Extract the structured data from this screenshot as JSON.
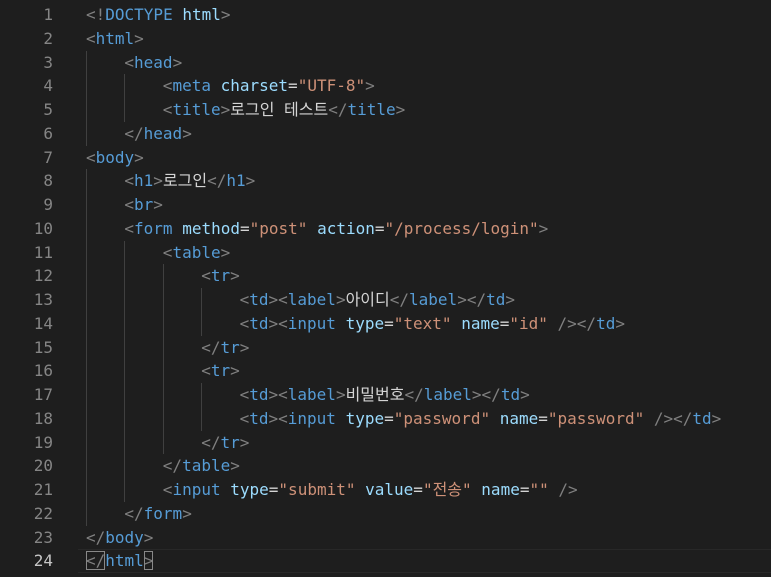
{
  "editor": {
    "current_line": 24,
    "colors": {
      "background": "#1e1e1e",
      "line_number": "#858585",
      "line_number_active": "#c6c6c6",
      "punctuation": "#808080",
      "tag": "#569cd6",
      "attribute": "#9cdcfe",
      "string": "#ce9178",
      "text": "#d4d4d4"
    },
    "lines": [
      {
        "n": "1",
        "indent": 0,
        "tokens": [
          [
            "punct",
            "<!"
          ],
          [
            "tag",
            "DOCTYPE"
          ],
          [
            "text",
            " "
          ],
          [
            "attr",
            "html"
          ],
          [
            "punct",
            ">"
          ]
        ]
      },
      {
        "n": "2",
        "indent": 0,
        "tokens": [
          [
            "punct",
            "<"
          ],
          [
            "tag",
            "html"
          ],
          [
            "punct",
            ">"
          ]
        ]
      },
      {
        "n": "3",
        "indent": 1,
        "tokens": [
          [
            "punct",
            "<"
          ],
          [
            "tag",
            "head"
          ],
          [
            "punct",
            ">"
          ]
        ]
      },
      {
        "n": "4",
        "indent": 2,
        "tokens": [
          [
            "punct",
            "<"
          ],
          [
            "tag",
            "meta"
          ],
          [
            "text",
            " "
          ],
          [
            "attr",
            "charset"
          ],
          [
            "eq",
            "="
          ],
          [
            "str",
            "\"UTF-8\""
          ],
          [
            "punct",
            ">"
          ]
        ]
      },
      {
        "n": "5",
        "indent": 2,
        "tokens": [
          [
            "punct",
            "<"
          ],
          [
            "tag",
            "title"
          ],
          [
            "punct",
            ">"
          ],
          [
            "text",
            "로그인 테스트"
          ],
          [
            "punct",
            "</"
          ],
          [
            "tag",
            "title"
          ],
          [
            "punct",
            ">"
          ]
        ]
      },
      {
        "n": "6",
        "indent": 1,
        "tokens": [
          [
            "punct",
            "</"
          ],
          [
            "tag",
            "head"
          ],
          [
            "punct",
            ">"
          ]
        ]
      },
      {
        "n": "7",
        "indent": 0,
        "tokens": [
          [
            "punct",
            "<"
          ],
          [
            "tag",
            "body"
          ],
          [
            "punct",
            ">"
          ]
        ]
      },
      {
        "n": "8",
        "indent": 1,
        "tokens": [
          [
            "punct",
            "<"
          ],
          [
            "tag",
            "h1"
          ],
          [
            "punct",
            ">"
          ],
          [
            "text",
            "로그인"
          ],
          [
            "punct",
            "</"
          ],
          [
            "tag",
            "h1"
          ],
          [
            "punct",
            ">"
          ]
        ]
      },
      {
        "n": "9",
        "indent": 1,
        "tokens": [
          [
            "punct",
            "<"
          ],
          [
            "tag",
            "br"
          ],
          [
            "punct",
            ">"
          ]
        ]
      },
      {
        "n": "10",
        "indent": 1,
        "tokens": [
          [
            "punct",
            "<"
          ],
          [
            "tag",
            "form"
          ],
          [
            "text",
            " "
          ],
          [
            "attr",
            "method"
          ],
          [
            "eq",
            "="
          ],
          [
            "str",
            "\"post\""
          ],
          [
            "text",
            " "
          ],
          [
            "attr",
            "action"
          ],
          [
            "eq",
            "="
          ],
          [
            "str",
            "\"/process/login\""
          ],
          [
            "punct",
            ">"
          ]
        ]
      },
      {
        "n": "11",
        "indent": 2,
        "tokens": [
          [
            "punct",
            "<"
          ],
          [
            "tag",
            "table"
          ],
          [
            "punct",
            ">"
          ]
        ]
      },
      {
        "n": "12",
        "indent": 3,
        "tokens": [
          [
            "punct",
            "<"
          ],
          [
            "tag",
            "tr"
          ],
          [
            "punct",
            ">"
          ]
        ]
      },
      {
        "n": "13",
        "indent": 4,
        "tokens": [
          [
            "punct",
            "<"
          ],
          [
            "tag",
            "td"
          ],
          [
            "punct",
            "><"
          ],
          [
            "tag",
            "label"
          ],
          [
            "punct",
            ">"
          ],
          [
            "text",
            "아이디"
          ],
          [
            "punct",
            "</"
          ],
          [
            "tag",
            "label"
          ],
          [
            "punct",
            "></"
          ],
          [
            "tag",
            "td"
          ],
          [
            "punct",
            ">"
          ]
        ]
      },
      {
        "n": "14",
        "indent": 4,
        "tokens": [
          [
            "punct",
            "<"
          ],
          [
            "tag",
            "td"
          ],
          [
            "punct",
            "><"
          ],
          [
            "tag",
            "input"
          ],
          [
            "text",
            " "
          ],
          [
            "attr",
            "type"
          ],
          [
            "eq",
            "="
          ],
          [
            "str",
            "\"text\""
          ],
          [
            "text",
            " "
          ],
          [
            "attr",
            "name"
          ],
          [
            "eq",
            "="
          ],
          [
            "str",
            "\"id\""
          ],
          [
            "text",
            " "
          ],
          [
            "punct",
            "/></"
          ],
          [
            "tag",
            "td"
          ],
          [
            "punct",
            ">"
          ]
        ]
      },
      {
        "n": "15",
        "indent": 3,
        "tokens": [
          [
            "punct",
            "</"
          ],
          [
            "tag",
            "tr"
          ],
          [
            "punct",
            ">"
          ]
        ]
      },
      {
        "n": "16",
        "indent": 3,
        "tokens": [
          [
            "punct",
            "<"
          ],
          [
            "tag",
            "tr"
          ],
          [
            "punct",
            ">"
          ]
        ]
      },
      {
        "n": "17",
        "indent": 4,
        "tokens": [
          [
            "punct",
            "<"
          ],
          [
            "tag",
            "td"
          ],
          [
            "punct",
            "><"
          ],
          [
            "tag",
            "label"
          ],
          [
            "punct",
            ">"
          ],
          [
            "text",
            "비밀번호"
          ],
          [
            "punct",
            "</"
          ],
          [
            "tag",
            "label"
          ],
          [
            "punct",
            "></"
          ],
          [
            "tag",
            "td"
          ],
          [
            "punct",
            ">"
          ]
        ]
      },
      {
        "n": "18",
        "indent": 4,
        "tokens": [
          [
            "punct",
            "<"
          ],
          [
            "tag",
            "td"
          ],
          [
            "punct",
            "><"
          ],
          [
            "tag",
            "input"
          ],
          [
            "text",
            " "
          ],
          [
            "attr",
            "type"
          ],
          [
            "eq",
            "="
          ],
          [
            "str",
            "\"password\""
          ],
          [
            "text",
            " "
          ],
          [
            "attr",
            "name"
          ],
          [
            "eq",
            "="
          ],
          [
            "str",
            "\"password\""
          ],
          [
            "text",
            " "
          ],
          [
            "punct",
            "/></"
          ],
          [
            "tag",
            "td"
          ],
          [
            "punct",
            ">"
          ]
        ]
      },
      {
        "n": "19",
        "indent": 3,
        "tokens": [
          [
            "punct",
            "</"
          ],
          [
            "tag",
            "tr"
          ],
          [
            "punct",
            ">"
          ]
        ]
      },
      {
        "n": "20",
        "indent": 2,
        "tokens": [
          [
            "punct",
            "</"
          ],
          [
            "tag",
            "table"
          ],
          [
            "punct",
            ">"
          ]
        ]
      },
      {
        "n": "21",
        "indent": 2,
        "tokens": [
          [
            "punct",
            "<"
          ],
          [
            "tag",
            "input"
          ],
          [
            "text",
            " "
          ],
          [
            "attr",
            "type"
          ],
          [
            "eq",
            "="
          ],
          [
            "str",
            "\"submit\""
          ],
          [
            "text",
            " "
          ],
          [
            "attr",
            "value"
          ],
          [
            "eq",
            "="
          ],
          [
            "str",
            "\"전송\""
          ],
          [
            "text",
            " "
          ],
          [
            "attr",
            "name"
          ],
          [
            "eq",
            "="
          ],
          [
            "str",
            "\"\""
          ],
          [
            "text",
            " "
          ],
          [
            "punct",
            "/>"
          ]
        ]
      },
      {
        "n": "22",
        "indent": 1,
        "tokens": [
          [
            "punct",
            "</"
          ],
          [
            "tag",
            "form"
          ],
          [
            "punct",
            ">"
          ]
        ]
      },
      {
        "n": "23",
        "indent": 0,
        "tokens": [
          [
            "punct",
            "</"
          ],
          [
            "tag",
            "body"
          ],
          [
            "punct",
            ">"
          ]
        ]
      },
      {
        "n": "24",
        "indent": 0,
        "tokens": [
          [
            "punct",
            "</"
          ],
          [
            "tag",
            "html"
          ],
          [
            "punct",
            ">"
          ]
        ]
      }
    ]
  }
}
